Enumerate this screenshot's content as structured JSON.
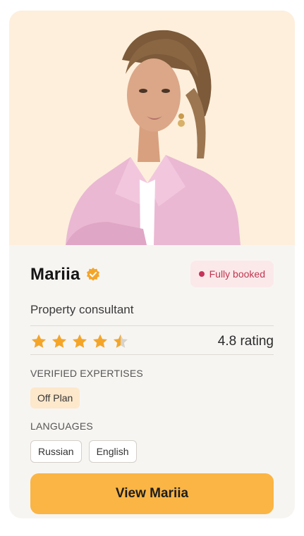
{
  "consultant": {
    "name": "Mariia",
    "role": "Property consultant",
    "status": "Fully booked",
    "rating": 4.8,
    "rating_text": "4.8 rating"
  },
  "expertise": {
    "label": "VERIFIED EXPERTISES",
    "items": [
      "Off Plan"
    ]
  },
  "languages": {
    "label": "LANGUAGES",
    "items": [
      "Russian",
      "English"
    ]
  },
  "cta": {
    "label": "View Mariia"
  },
  "icons": {
    "verified": "verified-check-icon",
    "star": "star-icon",
    "status": "status-dot"
  },
  "colors": {
    "accent": "#fbb544",
    "badge_bg": "#fbe9ea",
    "badge_text": "#c0364f",
    "star": "#f4a528",
    "photo_bg": "#fdefdc",
    "chip_expertise_bg": "#fde8cc"
  }
}
